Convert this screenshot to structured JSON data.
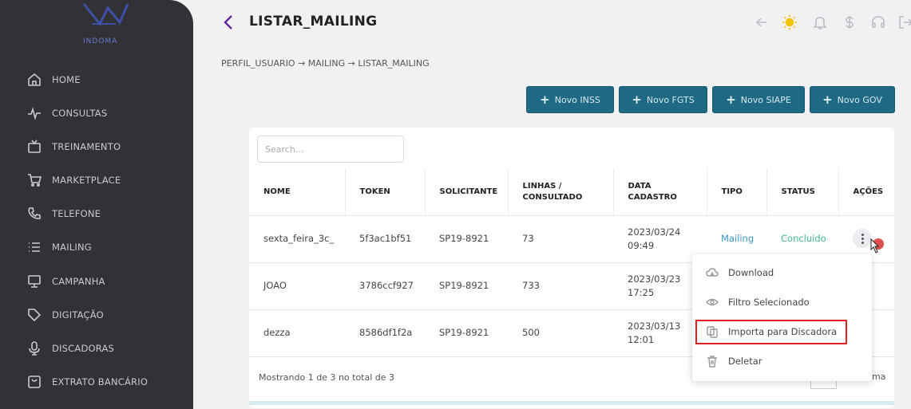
{
  "sidebar": {
    "logo_text": "INDOMA",
    "items": [
      {
        "label": "HOME",
        "icon": "home-icon"
      },
      {
        "label": "CONSULTAS",
        "icon": "pulse-icon"
      },
      {
        "label": "TREINAMENTO",
        "icon": "tv-icon"
      },
      {
        "label": "MARKETPLACE",
        "icon": "cart-icon"
      },
      {
        "label": "TELEFONE",
        "icon": "phone-icon"
      },
      {
        "label": "MAILING",
        "icon": "list-icon"
      },
      {
        "label": "CAMPANHA",
        "icon": "monitor-icon"
      },
      {
        "label": "DIGITAÇÃO",
        "icon": "tag-icon"
      },
      {
        "label": "DISCADORAS",
        "icon": "mic-icon"
      },
      {
        "label": "EXTRATO BANCÁRIO",
        "icon": "receipt-icon"
      }
    ]
  },
  "header": {
    "title": "LISTAR_MAILING",
    "breadcrumb": "PERFIL_USUARIO  →  MAILING  →  LISTAR_MAILING",
    "icons": [
      "arrow-left-icon",
      "sun-icon",
      "bell-icon",
      "dollar-icon",
      "headset-icon",
      "logout-icon"
    ],
    "sun_color": "#f5c400"
  },
  "buttons": {
    "novo_inss": "Novo INSS",
    "novo_fgts": "Novo FGTS",
    "novo_siape": "Novo SIAPE",
    "novo_gov": "Novo GOV"
  },
  "search": {
    "placeholder": "Search..."
  },
  "table": {
    "headers": {
      "nome": "NOME",
      "token": "TOKEN",
      "solicitante": "SOLICITANTE",
      "linhas_1": "LINHAS /",
      "linhas_2": "CONSULTADO",
      "data_1": "DATA",
      "data_2": "CADASTRO",
      "tipo": "TIPO",
      "status": "STATUS",
      "acoes": "AÇÕES"
    },
    "rows": [
      {
        "nome": "sexta_feira_3c_",
        "token": "5f3ac1bf51",
        "solicitante": "SP19-8921",
        "linhas": "73",
        "data": "2023/03/24",
        "hora": "09:49",
        "tipo": "Mailing",
        "status": "Concluido"
      },
      {
        "nome": "JOAO",
        "token": "3786ccf927",
        "solicitante": "SP19-8921",
        "linhas": "733",
        "data": "2023/03/23",
        "hora": "17:25",
        "tipo": "",
        "status": ""
      },
      {
        "nome": "dezza",
        "token": "8586df1f2a",
        "solicitante": "SP19-8921",
        "linhas": "500",
        "data": "2023/03/13",
        "hora": "12:01",
        "tipo": "",
        "status": ""
      }
    ],
    "footer": "Mostrando 1 de 3 no total de 3",
    "pager_fragment": "ma"
  },
  "menu": {
    "download": "Download",
    "filtro": "Filtro Selecionado",
    "importa": "Importa para Discadora",
    "deletar": "Deletar"
  }
}
